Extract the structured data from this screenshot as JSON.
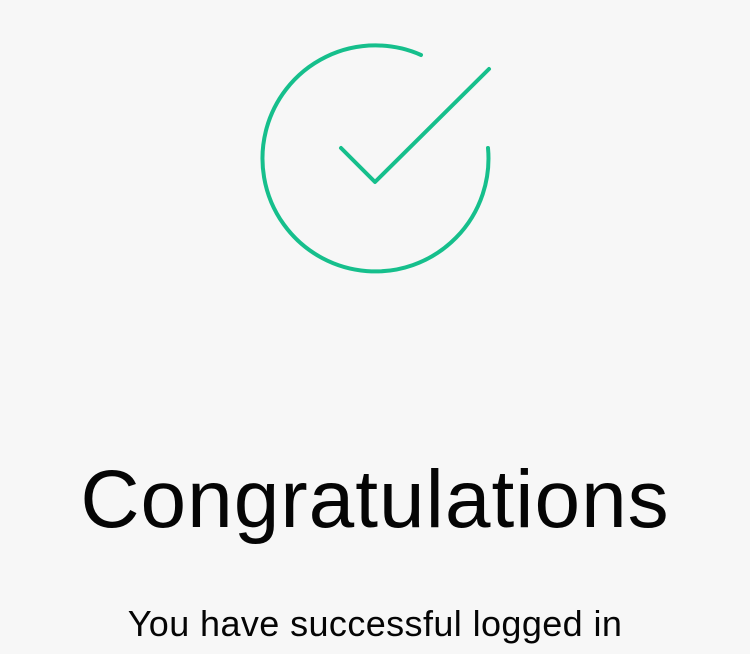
{
  "success": {
    "icon": "check-circle-icon",
    "accent_color": "#16bf8c",
    "title": "Congratulations",
    "message": "You have successful logged in"
  }
}
